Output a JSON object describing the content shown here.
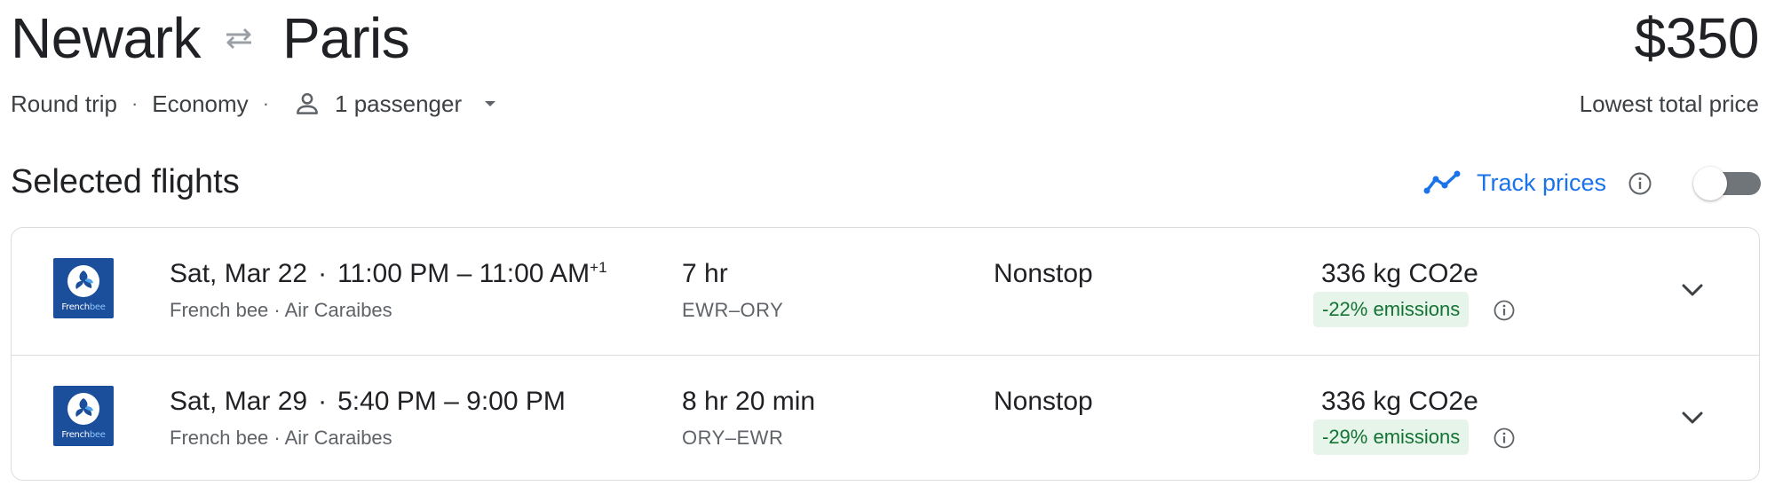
{
  "header": {
    "origin": "Newark",
    "destination": "Paris",
    "swap_icon": "swap-arrows-icon",
    "price": "$350",
    "price_caption": "Lowest total price"
  },
  "trip_options": {
    "trip_type": "Round trip",
    "separator": "·",
    "cabin": "Economy",
    "passengers": "1 passenger",
    "passenger_icon": "person-icon",
    "dropdown_icon": "caret-down-icon"
  },
  "selected_section": {
    "title": "Selected flights",
    "track_label": "Track prices",
    "track_icon": "trend-line-icon",
    "info_icon": "info-icon",
    "toggle_on": false
  },
  "colors": {
    "accent": "#1a73e8",
    "text": "#202124",
    "secondary": "#5f6368",
    "emissions_bg": "#e6f4ea",
    "emissions_text": "#137333",
    "logo_bg": "#1b4e9b"
  },
  "flights": [
    {
      "logo_text": "French",
      "logo_text_accent": "bee",
      "date": "Sat, Mar 22",
      "dot": "·",
      "time_range": "11:00 PM – 11:00 AM",
      "day_offset": "+1",
      "airlines": "French bee · Air Caraibes",
      "duration": "7 hr",
      "airports": "EWR–ORY",
      "stops": "Nonstop",
      "co2": "336 kg CO2e",
      "emissions": "-22% emissions"
    },
    {
      "logo_text": "French",
      "logo_text_accent": "bee",
      "date": "Sat, Mar 29",
      "dot": "·",
      "time_range": "5:40 PM – 9:00 PM",
      "day_offset": "",
      "airlines": "French bee · Air Caraibes",
      "duration": "8 hr 20 min",
      "airports": "ORY–EWR",
      "stops": "Nonstop",
      "co2": "336 kg CO2e",
      "emissions": "-29% emissions"
    }
  ]
}
